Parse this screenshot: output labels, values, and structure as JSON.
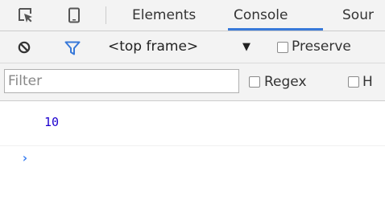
{
  "tabbar": {
    "icons": [
      "inspect-element-icon",
      "device-mode-icon"
    ],
    "tabs": [
      {
        "label": "Elements",
        "active": false
      },
      {
        "label": "Console",
        "active": true
      },
      {
        "label": "Sour",
        "active": false
      }
    ]
  },
  "toolbar": {
    "context_label": "<top frame>",
    "context_arrow": "▼",
    "preserve_label": "Preserve",
    "filter_active_color": "#3879d9"
  },
  "filterbar": {
    "filter_placeholder": "Filter",
    "filter_value": "",
    "regex_label": "Regex",
    "hide_label": "H"
  },
  "console": {
    "messages": [
      {
        "text": "10"
      }
    ],
    "prompt": "›"
  },
  "colors": {
    "accent": "#3879d9",
    "number": "#1c00cf",
    "toolbar_bg": "#f3f3f3"
  }
}
